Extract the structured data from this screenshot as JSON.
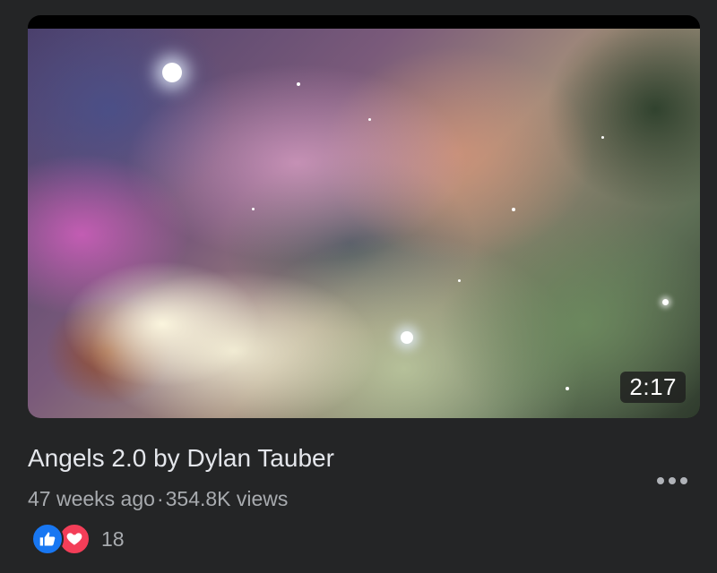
{
  "video": {
    "title": "Angels 2.0 by Dylan Tauber",
    "duration": "2:17",
    "posted": "47 weeks ago",
    "separator": "·",
    "views": "354.8K views",
    "thumbnail_icon": "nebula-thumbnail"
  },
  "reactions": {
    "icons": [
      "like-icon",
      "love-icon"
    ],
    "count": "18",
    "colors": {
      "like": "#1877f2",
      "love": "#f33e58"
    }
  },
  "actions": {
    "more_icon": "more-options-icon"
  },
  "theme": {
    "background": "#242526",
    "title_color": "#e4e6eb",
    "meta_color": "#a8abaf"
  }
}
